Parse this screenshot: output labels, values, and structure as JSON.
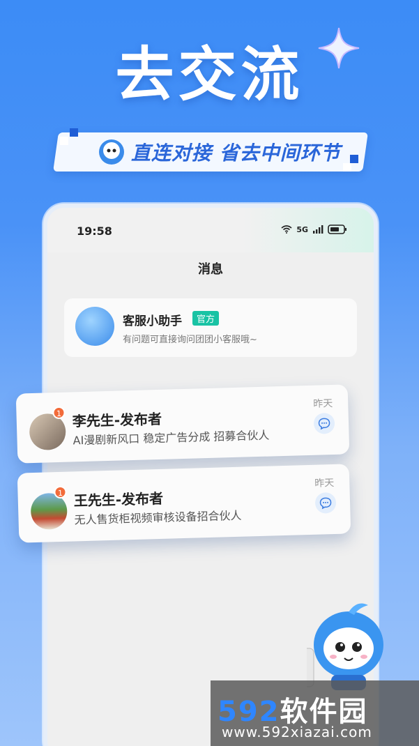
{
  "hero": {
    "title": "去交流",
    "subtitle": "直连对接 省去中间环节"
  },
  "phone": {
    "status_time": "19:58",
    "network": "5G",
    "screen_title": "消息",
    "assistant": {
      "name": "客服小助手",
      "badge": "官方",
      "message": "有问题可直接询问团团小客服哦~"
    },
    "chats": [
      {
        "name": "李先生-发布者",
        "message": "AI漫剧新风口 稳定广告分成 招募合伙人",
        "time": "昨天",
        "unread": "1"
      },
      {
        "name": "王先生-发布者",
        "message": "无人售货柜视频审核设备招合伙人",
        "time": "昨天",
        "unread": "1"
      }
    ]
  },
  "watermark": {
    "number": "592",
    "text": "软件园",
    "url": "www.592xiazai.com"
  },
  "colors": {
    "brand": "#2a66d9",
    "badge": "#19c3a4",
    "unread": "#f26b3a"
  }
}
